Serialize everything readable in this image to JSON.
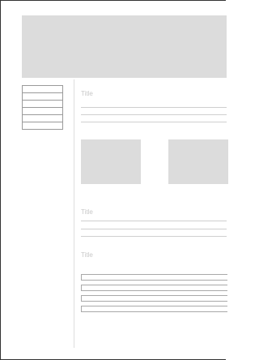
{
  "sections": [
    {
      "title": "Title"
    },
    {
      "title": "Title"
    },
    {
      "title": "Title"
    }
  ],
  "sidebar": {
    "items": [
      "",
      "",
      "",
      "",
      "",
      ""
    ]
  },
  "colors": {
    "placeholder_fill": "#dcdcdc",
    "title_text": "#c8c8c8",
    "rule": "#cfcfcf"
  }
}
